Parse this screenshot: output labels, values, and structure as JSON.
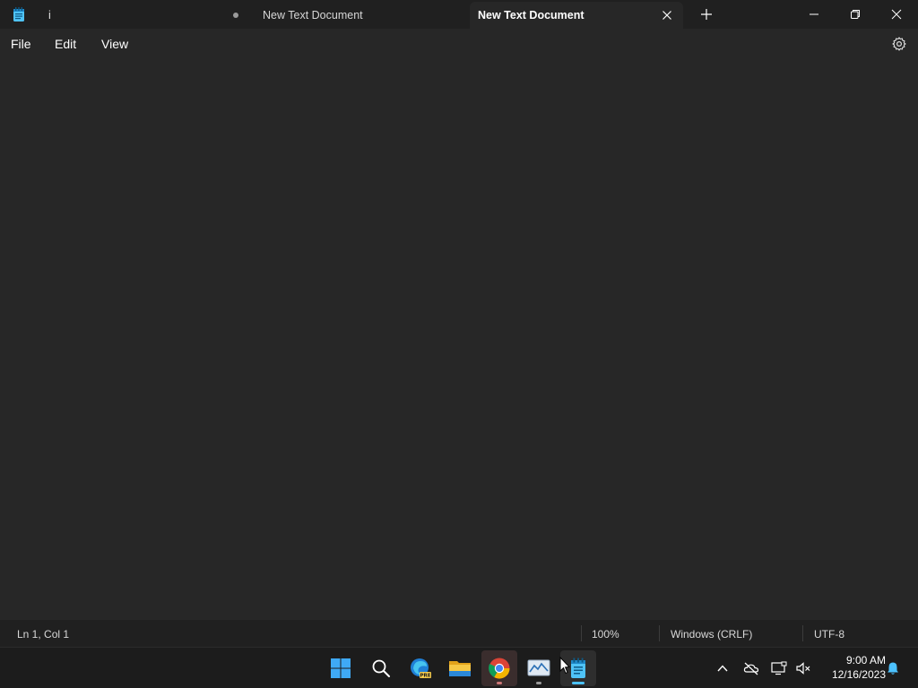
{
  "window": {
    "tabs": [
      {
        "label": "i",
        "unsaved": true
      },
      {
        "label": "New Text Document"
      },
      {
        "label": "New Text Document",
        "active": true
      }
    ],
    "icons": {
      "app": "notepad-icon",
      "close_tab": "close-icon",
      "new_tab": "plus-icon",
      "minimize": "minimize-icon",
      "maximize": "restore-icon",
      "close": "close-icon"
    }
  },
  "menu": {
    "file": "File",
    "edit": "Edit",
    "view": "View",
    "settings_icon": "gear-icon"
  },
  "editor": {
    "content": ""
  },
  "status": {
    "position": "Ln 1, Col 1",
    "zoom": "100%",
    "line_ending": "Windows (CRLF)",
    "encoding": "UTF-8"
  },
  "taskbar": {
    "apps": [
      "start-icon",
      "search-icon",
      "edge-pre-icon",
      "file-explorer-icon",
      "chrome-icon",
      "stock-app-icon",
      "notepad-icon"
    ],
    "tray": [
      "chevron-up-icon",
      "onedrive-offline-icon",
      "display-icon",
      "volume-muted-icon",
      "bell-icon"
    ],
    "time": "9:00 AM",
    "date": "12/16/2023"
  },
  "colors": {
    "titlebar": "#202020",
    "editor_bg": "#272727",
    "taskbar": "#1c1c1c",
    "accent": "#4cc2ff"
  }
}
